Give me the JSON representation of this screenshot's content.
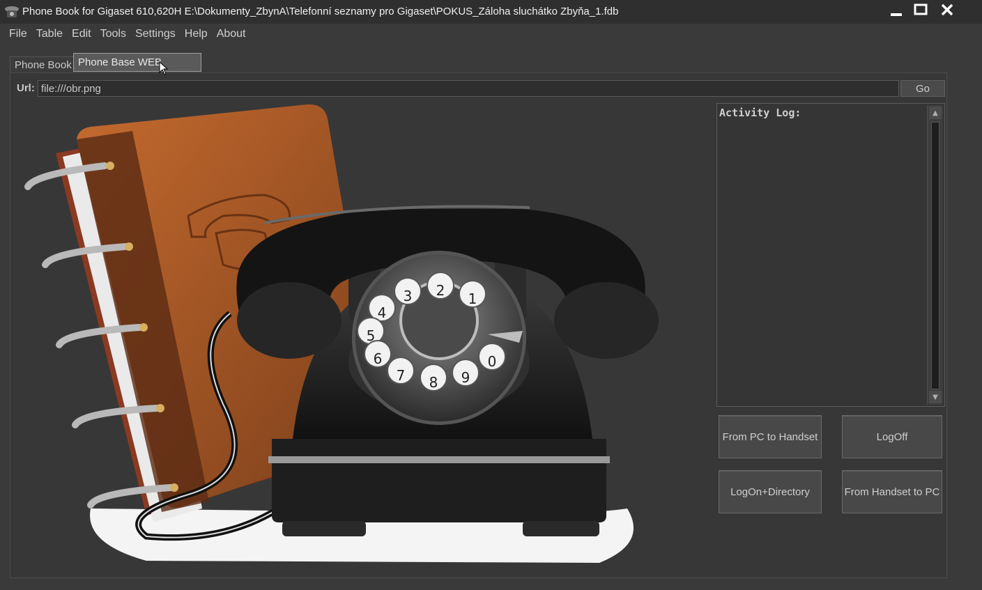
{
  "window": {
    "title": "Phone Book for Gigaset 610,620H     E:\\Dokumenty_ZbynA\\Telefonní seznamy pro Gigaset\\POKUS_Záloha sluchátko Zbyňa_1.fdb",
    "icons": {
      "app": "phone-icon",
      "minimize": "minimize-icon",
      "maximize": "maximize-icon",
      "close": "close-icon"
    }
  },
  "menu": {
    "items": [
      "File",
      "Table",
      "Edit",
      "Tools",
      "Settings",
      "Help",
      "About"
    ]
  },
  "tabs": {
    "items": [
      "Phone Book",
      "Phone Base WEB interface"
    ],
    "active": 1
  },
  "url": {
    "label": "Url:",
    "value": "file:///obr.png",
    "go_label": "Go"
  },
  "log": {
    "title": "Activity Log:"
  },
  "actions": {
    "from_pc_to_handset": "From PC to Handset",
    "logoff": "LogOff",
    "logon_directory": "LogOn+Directory",
    "from_handset_to_pc": "From Handset to PC"
  },
  "dial": {
    "digits": [
      "1",
      "2",
      "3",
      "4",
      "5",
      "6",
      "7",
      "8",
      "9",
      "0"
    ]
  },
  "colors": {
    "background": "#3a3a3a",
    "panel": "#373737",
    "book_cover": "#b8612a"
  }
}
